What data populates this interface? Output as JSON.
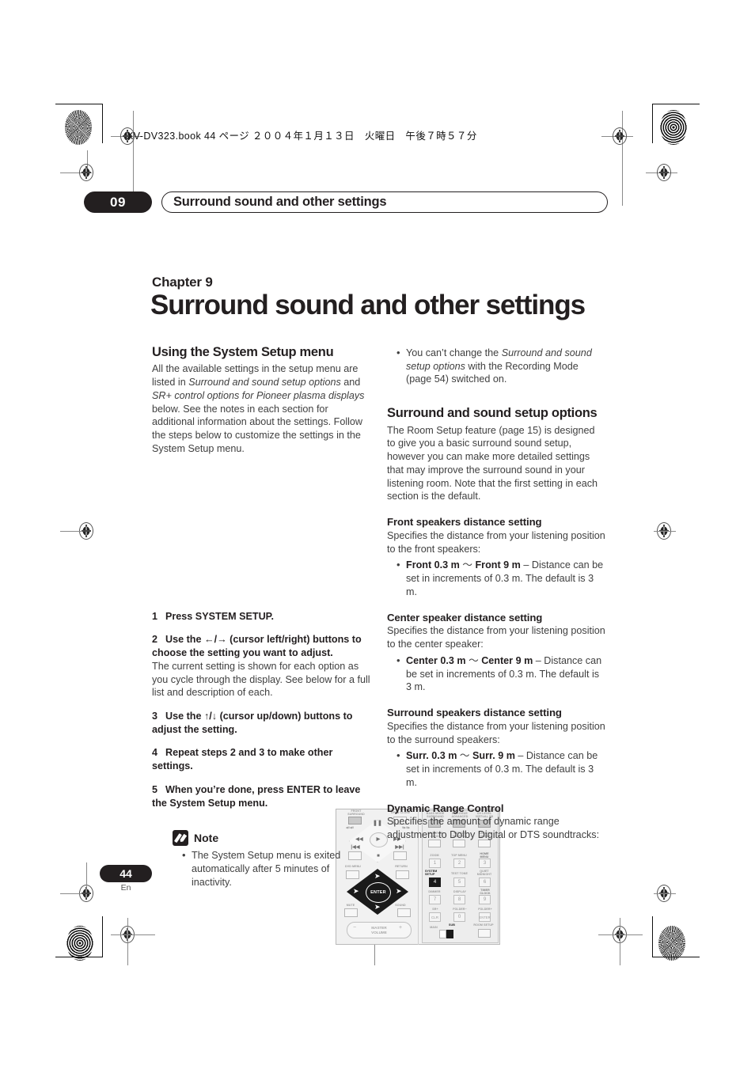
{
  "header": {
    "file_line": "XV-DV323.book  44 ページ  ２００４年１月１３日　火曜日　午後７時５７分"
  },
  "running_head": {
    "chapter_number": "09",
    "chapter_title": "Surround sound and other settings"
  },
  "title_block": {
    "chapter_label": "Chapter 9",
    "chapter_title": "Surround sound and other settings"
  },
  "left_column": {
    "section_heading": "Using the System Setup menu",
    "intro_parts": {
      "a": "All the available settings in the setup menu are listed in ",
      "b_italic": "Surround and sound setup options",
      "c": " and ",
      "d_italic": "SR+ control options for Pioneer plasma displays",
      "e": " below. See the notes in each section for additional information about the settings. Follow the steps below to customize the settings in the System Setup menu."
    },
    "steps": [
      {
        "num": "1",
        "lead": "Press SYSTEM SETUP.",
        "explanation": ""
      },
      {
        "num": "2",
        "lead": "Use the ←/→ (cursor left/right) buttons to choose the setting you want to adjust.",
        "explanation": "The current setting is shown for each option as you cycle through the display. See below for a full list and description of each."
      },
      {
        "num": "3",
        "lead": "Use the ↑/↓ (cursor up/down) buttons to adjust the setting.",
        "explanation": ""
      },
      {
        "num": "4",
        "lead": "Repeat steps 2 and 3 to make other settings.",
        "explanation": ""
      },
      {
        "num": "5",
        "lead": "When you’re done, press ENTER to leave the System Setup menu.",
        "explanation": ""
      }
    ],
    "note": {
      "title": "Note",
      "icon": "pencil-icon",
      "bullets": [
        "The System Setup menu is exited automatically after 5 minutes of inactivity."
      ]
    }
  },
  "right_column": {
    "top_bullet": {
      "a": "You can’t change the ",
      "b_italic": "Surround and sound setup options",
      "c": " with the Recording Mode (page 54) switched on."
    },
    "sections": [
      {
        "heading": "Surround and sound setup options",
        "body": "The Room Setup feature (page 15) is designed to give you a basic surround sound setup, however you can make more detailed settings that may improve the surround sound in your listening room. Note that the first setting in each section is the default."
      },
      {
        "heading": "Front speakers distance setting",
        "body": "Specifies the distance from your listening position to the front speakers:",
        "bullet": {
          "bold_a": "Front 0.3 m",
          "tilde": " ～ ",
          "bold_b": "Front 9 m",
          "rest": " – Distance can be set in increments of 0.3 m. The default is 3 m."
        }
      },
      {
        "heading": "Center speaker distance setting",
        "body": "Specifies the distance from your listening position to the center speaker:",
        "bullet": {
          "bold_a": "Center 0.3 m",
          "tilde": " ～ ",
          "bold_b": "Center 9 m",
          "rest": " – Distance can be set in increments of 0.3 m. The default is 3 m."
        }
      },
      {
        "heading": "Surround speakers distance setting",
        "body": "Specifies the distance from your listening position to the surround speakers:",
        "bullet": {
          "bold_a": "Surr. 0.3 m",
          "tilde": " ～ ",
          "bold_b": "Surr. 9 m",
          "rest": " – Distance can be set in increments of 0.3 m. The default is 3 m."
        }
      },
      {
        "heading": "Dynamic Range Control",
        "body": "Specifies the amount of dynamic range adjustment to Dolby Digital or DTS soundtracks:",
        "bullet": null
      }
    ]
  },
  "footer": {
    "page_number": "44",
    "language": "En"
  },
  "remote_illustration": {
    "left_panel_labels": {
      "front_surround": "FRONT SURROUND",
      "open_close": "OPEN CLOSE",
      "dvd_menu": "DVD MENU",
      "return": "RETURN",
      "mute": "MUTE",
      "sound": "SOUND",
      "enter": "ENTER",
      "master_volume": "MASTER VOLUME",
      "minus": "−",
      "plus": "+",
      "rev_scan": "◀◀",
      "fwd_scan": "▶▶",
      "play": "▶",
      "pause": "‖",
      "stop": "■",
      "prev": "|◀◀",
      "next": "▶▶|",
      "slow_rev": "◀I / ◀II",
      "slow_fwd": "II▶ / I▶"
    },
    "right_panel_labels": {
      "row1": [
        "BASS MODE SURROUND",
        "DIALOGUE ADVANCED",
        "CH LEVEL VIRTUAL SB"
      ],
      "row2": [
        "PROGRAM AUDIO",
        "REPEAT SUBTITLE",
        "RANDOM ANGLE"
      ],
      "row3": [
        "ZOOM",
        "TOP MENU",
        "HOME MENU"
      ],
      "row3_nums": [
        "1",
        "2",
        "3"
      ],
      "row4": [
        "SYSTEM SETUP",
        "TEST TONE",
        "QUIET MIDNIGHT"
      ],
      "row4_nums": [
        "4",
        "5",
        "6"
      ],
      "row5": [
        "DIMMER",
        "DISPLAY",
        "TIMER CLOCK"
      ],
      "row5_nums": [
        "7",
        "8",
        "9"
      ],
      "row6": [
        "SR+",
        "FOLDER−",
        "FOLDER+"
      ],
      "row6_nums": [
        "CLR",
        "0",
        "ENTER"
      ],
      "row7": [
        "MAIN",
        "SUB",
        "ROOM SETUP"
      ]
    },
    "highlighted_button": "SYSTEM SETUP"
  }
}
